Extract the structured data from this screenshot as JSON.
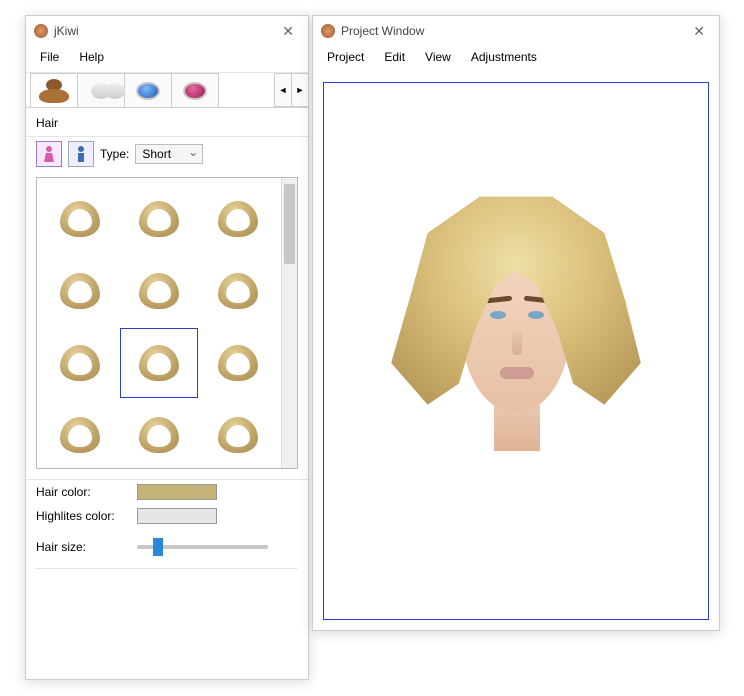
{
  "main_window": {
    "title": "jKiwi",
    "menu": {
      "file": "File",
      "help": "Help"
    },
    "tabs": {
      "hair": "hair-bun-icon",
      "foundation": "jars-icon",
      "eyeshadow": "blue-compact-icon",
      "lipstick": "red-compact-icon"
    },
    "section_label": "Hair",
    "gender": {
      "female_selected": true
    },
    "type_label": "Type:",
    "type_value": "Short",
    "hair_color_label": "Hair color:",
    "highlights_label": "Highlites color:",
    "hair_size_label": "Hair size:",
    "thumbs_selected_index": 7,
    "thumbs_count": 12
  },
  "project_window": {
    "title": "Project Window",
    "menu": {
      "project": "Project",
      "edit": "Edit",
      "view": "View",
      "adjustments": "Adjustments"
    }
  }
}
